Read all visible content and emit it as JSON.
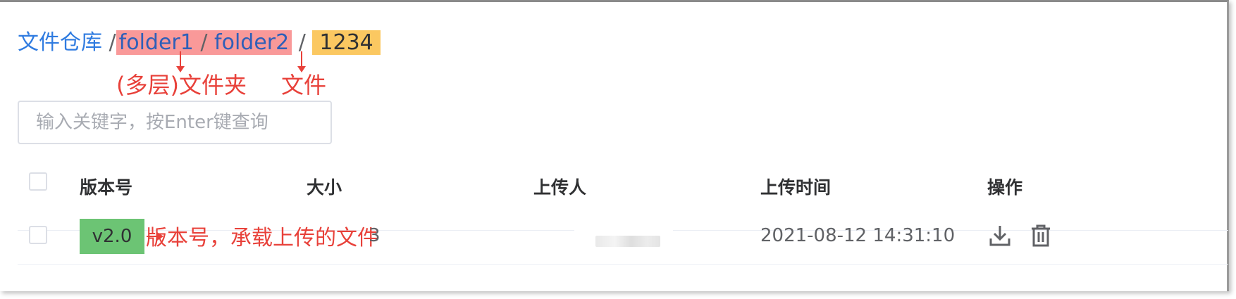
{
  "breadcrumb": {
    "root": "文件仓库",
    "separator": "/",
    "folders": [
      "folder1",
      "folder2"
    ],
    "file": "1234"
  },
  "annotations": {
    "folders": "(多层)文件夹",
    "file": "文件",
    "version": "版本号，承载上传的文件"
  },
  "search": {
    "placeholder": "输入关键字，按Enter键查询",
    "value": ""
  },
  "table": {
    "columns": [
      "版本号",
      "大小",
      "上传人",
      "上传时间",
      "操作"
    ],
    "rows": [
      {
        "version": "v2.0",
        "size_fragment": "3",
        "uploader": "",
        "upload_time": "2021-08-12 14:31:10"
      }
    ]
  },
  "icons": {
    "download": "download-icon",
    "delete": "trash-icon"
  },
  "colors": {
    "link": "#2f7be0",
    "folder_highlight": "#f99999",
    "file_highlight": "#fbc861",
    "version_highlight": "#6cc474",
    "annotation": "#e8413a"
  }
}
